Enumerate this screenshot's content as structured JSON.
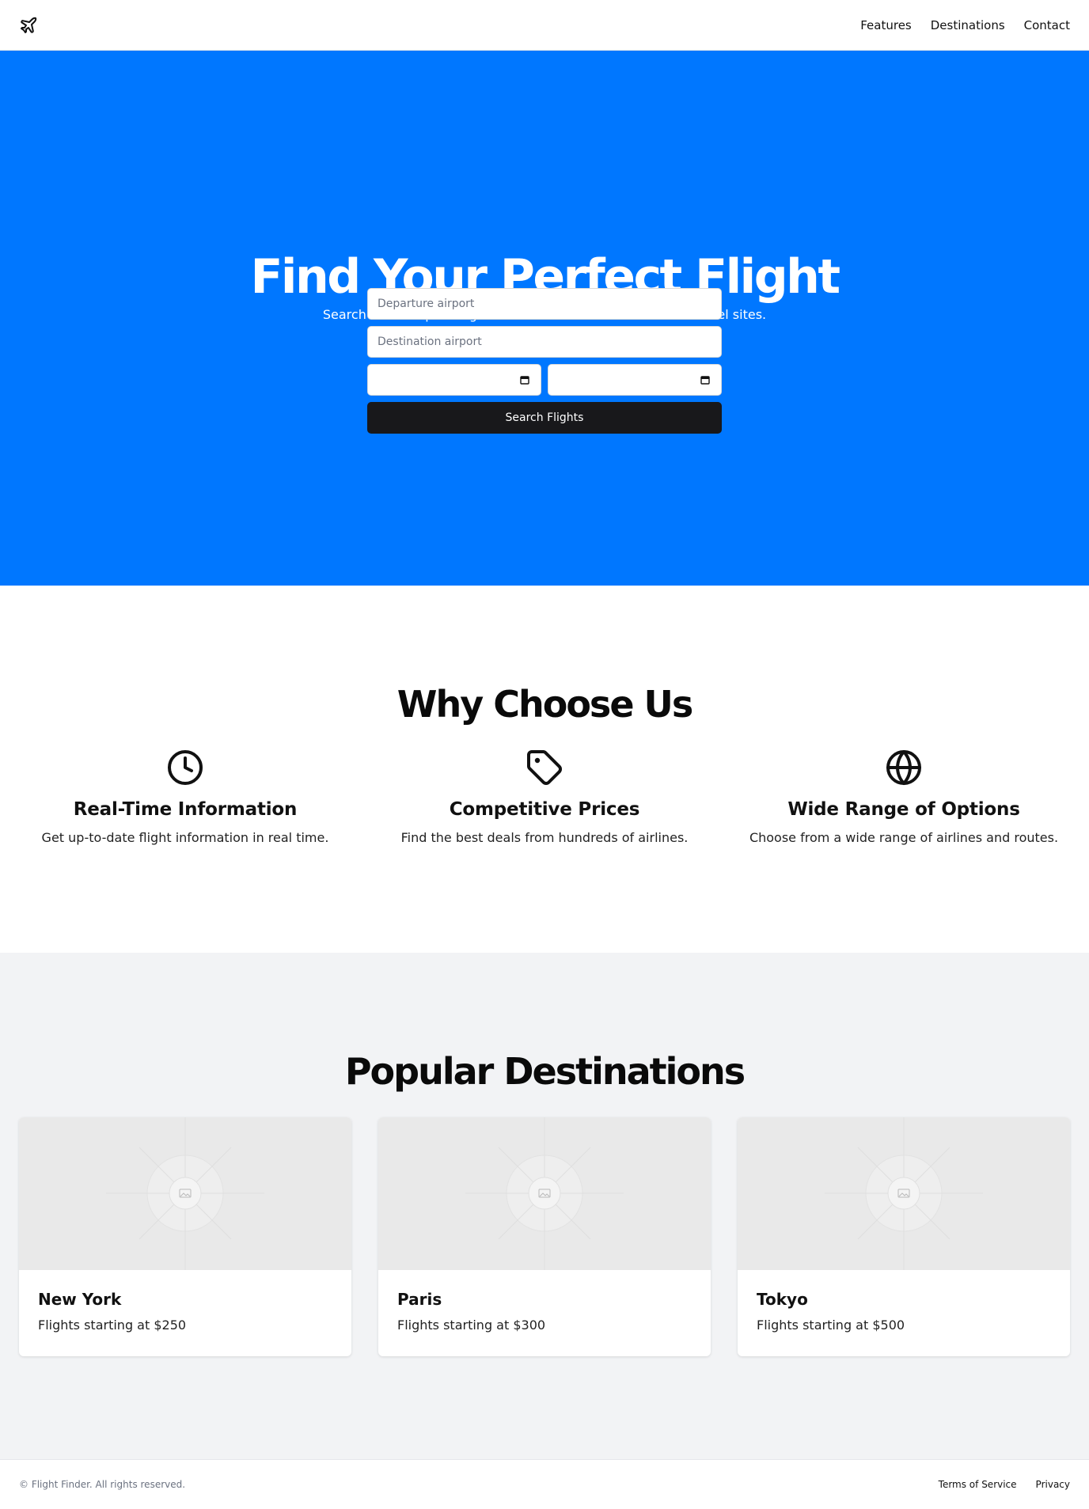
{
  "header": {
    "logo_icon": "plane-icon",
    "nav": [
      {
        "label": "Features"
      },
      {
        "label": "Destinations"
      },
      {
        "label": "Contact"
      }
    ]
  },
  "hero": {
    "title": "Find Your Perfect Flight",
    "subtitle": "Search and compare flights from hundreds of airlines and travel sites.",
    "departure_placeholder": "Departure airport",
    "destination_placeholder": "Destination airport",
    "depart_date_value": "",
    "return_date_value": "",
    "search_label": "Search Flights",
    "background_color": "#0077ff"
  },
  "features": {
    "title": "Why Choose Us",
    "items": [
      {
        "icon": "clock-icon",
        "title": "Real-Time Information",
        "text": "Get up-to-date flight information in real time."
      },
      {
        "icon": "tag-icon",
        "title": "Competitive Prices",
        "text": "Find the best deals from hundreds of airlines."
      },
      {
        "icon": "globe-icon",
        "title": "Wide Range of Options",
        "text": "Choose from a wide range of airlines and routes."
      }
    ]
  },
  "destinations": {
    "title": "Popular Destinations",
    "items": [
      {
        "name": "New York",
        "price": "Flights starting at $250"
      },
      {
        "name": "Paris",
        "price": "Flights starting at $300"
      },
      {
        "name": "Tokyo",
        "price": "Flights starting at $500"
      }
    ]
  },
  "footer": {
    "copyright": "© Flight Finder. All rights reserved.",
    "links": [
      {
        "label": "Terms of Service"
      },
      {
        "label": "Privacy"
      }
    ]
  }
}
